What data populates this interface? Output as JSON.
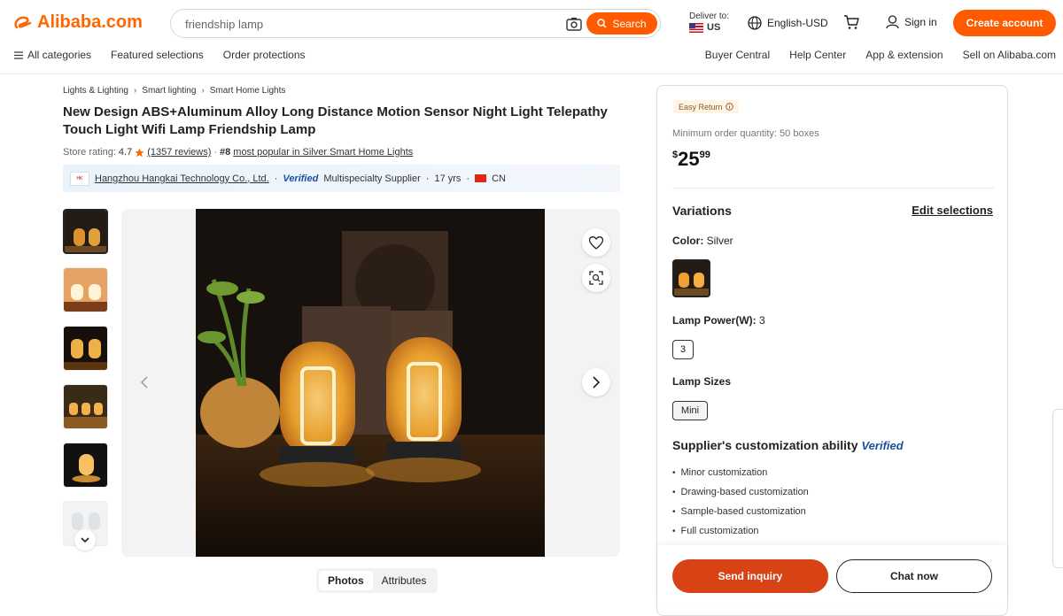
{
  "header": {
    "logo_text": "Alibaba.com",
    "search_value": "friendship lamp",
    "search_button": "Search",
    "deliver_label": "Deliver to:",
    "deliver_country": "US",
    "language": "English-USD",
    "signin": "Sign in",
    "create_account": "Create account"
  },
  "nav": {
    "left": [
      "All categories",
      "Featured selections",
      "Order protections"
    ],
    "right": [
      "Buyer Central",
      "Help Center",
      "App & extension",
      "Sell on Alibaba.com"
    ]
  },
  "breadcrumb": [
    "Lights & Lighting",
    "Smart lighting",
    "Smart Home Lights"
  ],
  "product": {
    "title": "New Design ABS+Aluminum Alloy Long Distance Motion Sensor Night Light Telepathy Touch Light Wifi Lamp Friendship Lamp",
    "rating_label": "Store rating:",
    "rating_value": "4.7",
    "reviews": "(1357 reviews)",
    "rank": "#8",
    "rank_text": "most popular in Silver Smart Home Lights"
  },
  "supplier": {
    "name": "Hangzhou Hangkai Technology Co., Ltd.",
    "verified": "Verified",
    "type": "Multispecialty Supplier",
    "years": "17 yrs",
    "country": "CN"
  },
  "gallery": {
    "tabs": [
      "Photos",
      "Attributes"
    ],
    "active_tab": "Photos"
  },
  "order": {
    "easy_return": "Easy Return",
    "moq": "Minimum order quantity: 50 boxes",
    "price_symbol": "$",
    "price_main": "25",
    "price_cents": "99"
  },
  "variations": {
    "heading": "Variations",
    "edit": "Edit selections",
    "color_label": "Color:",
    "color_value": "Silver",
    "power_label": "Lamp Power(W):",
    "power_value": "3",
    "power_option": "3",
    "sizes_label": "Lamp Sizes",
    "size_option": "Mini"
  },
  "customization": {
    "heading": "Supplier's customization ability",
    "verified": "Verified",
    "items": [
      "Minor customization",
      "Drawing-based customization",
      "Sample-based customization",
      "Full customization"
    ]
  },
  "actions": {
    "send_inquiry": "Send inquiry",
    "chat_now": "Chat now"
  },
  "colors": {
    "brand_orange": "#ff5a00",
    "inquiry_red": "#d84316",
    "verified_blue": "#1a4fa0"
  }
}
